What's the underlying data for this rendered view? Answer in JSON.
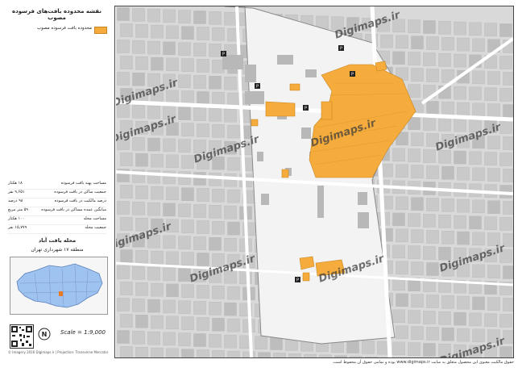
{
  "title": "نقشه محدوده بافت‌های فرسوده مصوب",
  "legend": {
    "label": "محدوده بافت فرسوده مصوب",
    "color": "#f5ac3c"
  },
  "stats": [
    {
      "label": "مساحت پهنه بافت فرسوده",
      "value": "۱۸ هکتار"
    },
    {
      "label": "جمعیت ساکن در بافت فرسوده",
      "value": "۹,۶۵۱ نفر"
    },
    {
      "label": "درصد مالکیت در بافت فرسوده",
      "value": "۹۸ درصد"
    },
    {
      "label": "میانگین عمده مساکن در بافت فرسوده",
      "value": "۵۹ متر مربع"
    },
    {
      "label": "مساحت محله",
      "value": "۱۰۰ هکتار"
    },
    {
      "label": "جمعیت محله",
      "value": "۱۵,۷۷۹ نفر"
    }
  ],
  "area_name": "محله یافت آباد",
  "region": "منطقه ۱۷ شهرداری تهران",
  "scale": "Scale = 1:9,000",
  "credit_small": "© Imagery 2016 Digimaps.ir | Projection: Transverse Mercator",
  "footer": "حقوق مالکیت معنوی این محصول متعلق به سایت www.digimaps.ir بوده و تمامی حقوق آن محفوظ است.",
  "watermarks": [
    "Digimaps.ir",
    "Digimaps.ir",
    "Digimaps.ir",
    "Digimaps.ir",
    "Digimaps.ir",
    "Digimaps.ir",
    "Digimaps.ir",
    "Digimaps.ir",
    "Digimaps.ir",
    "Digimaps.ir",
    "Digimaps.ir"
  ],
  "colors": {
    "decayed": "#f5ac3c",
    "blocks": "#c8c8c8",
    "roads": "#ffffff",
    "neighborhood": "#f3f3f3"
  }
}
